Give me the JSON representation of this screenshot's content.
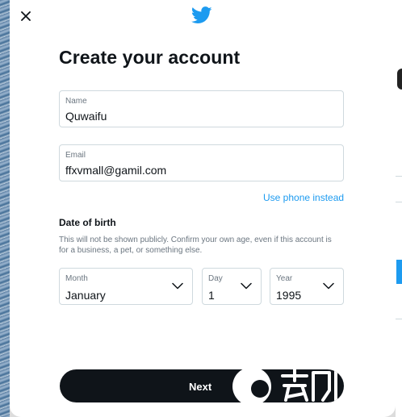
{
  "modal": {
    "close_icon": "close-icon",
    "logo_icon": "twitter-bird-icon",
    "title": "Create your account"
  },
  "form": {
    "name": {
      "label": "Name",
      "value": "Quwaifu"
    },
    "email": {
      "label": "Email",
      "value": "ffxvmall@gamil.com"
    },
    "use_phone_link": "Use phone instead",
    "dob": {
      "heading": "Date of birth",
      "description": "This will not be shown publicly. Confirm your own age, even if this account is for a business, a pet, or something else.",
      "month": {
        "label": "Month",
        "value": "January"
      },
      "day": {
        "label": "Day",
        "value": "1"
      },
      "year": {
        "label": "Year",
        "value": "1995"
      }
    },
    "next_label": "Next"
  },
  "colors": {
    "accent": "#1d9bf0",
    "text_primary": "#0f1419",
    "text_secondary": "#6b7680",
    "border": "#cfd9de",
    "button_bg": "#0f1419"
  }
}
